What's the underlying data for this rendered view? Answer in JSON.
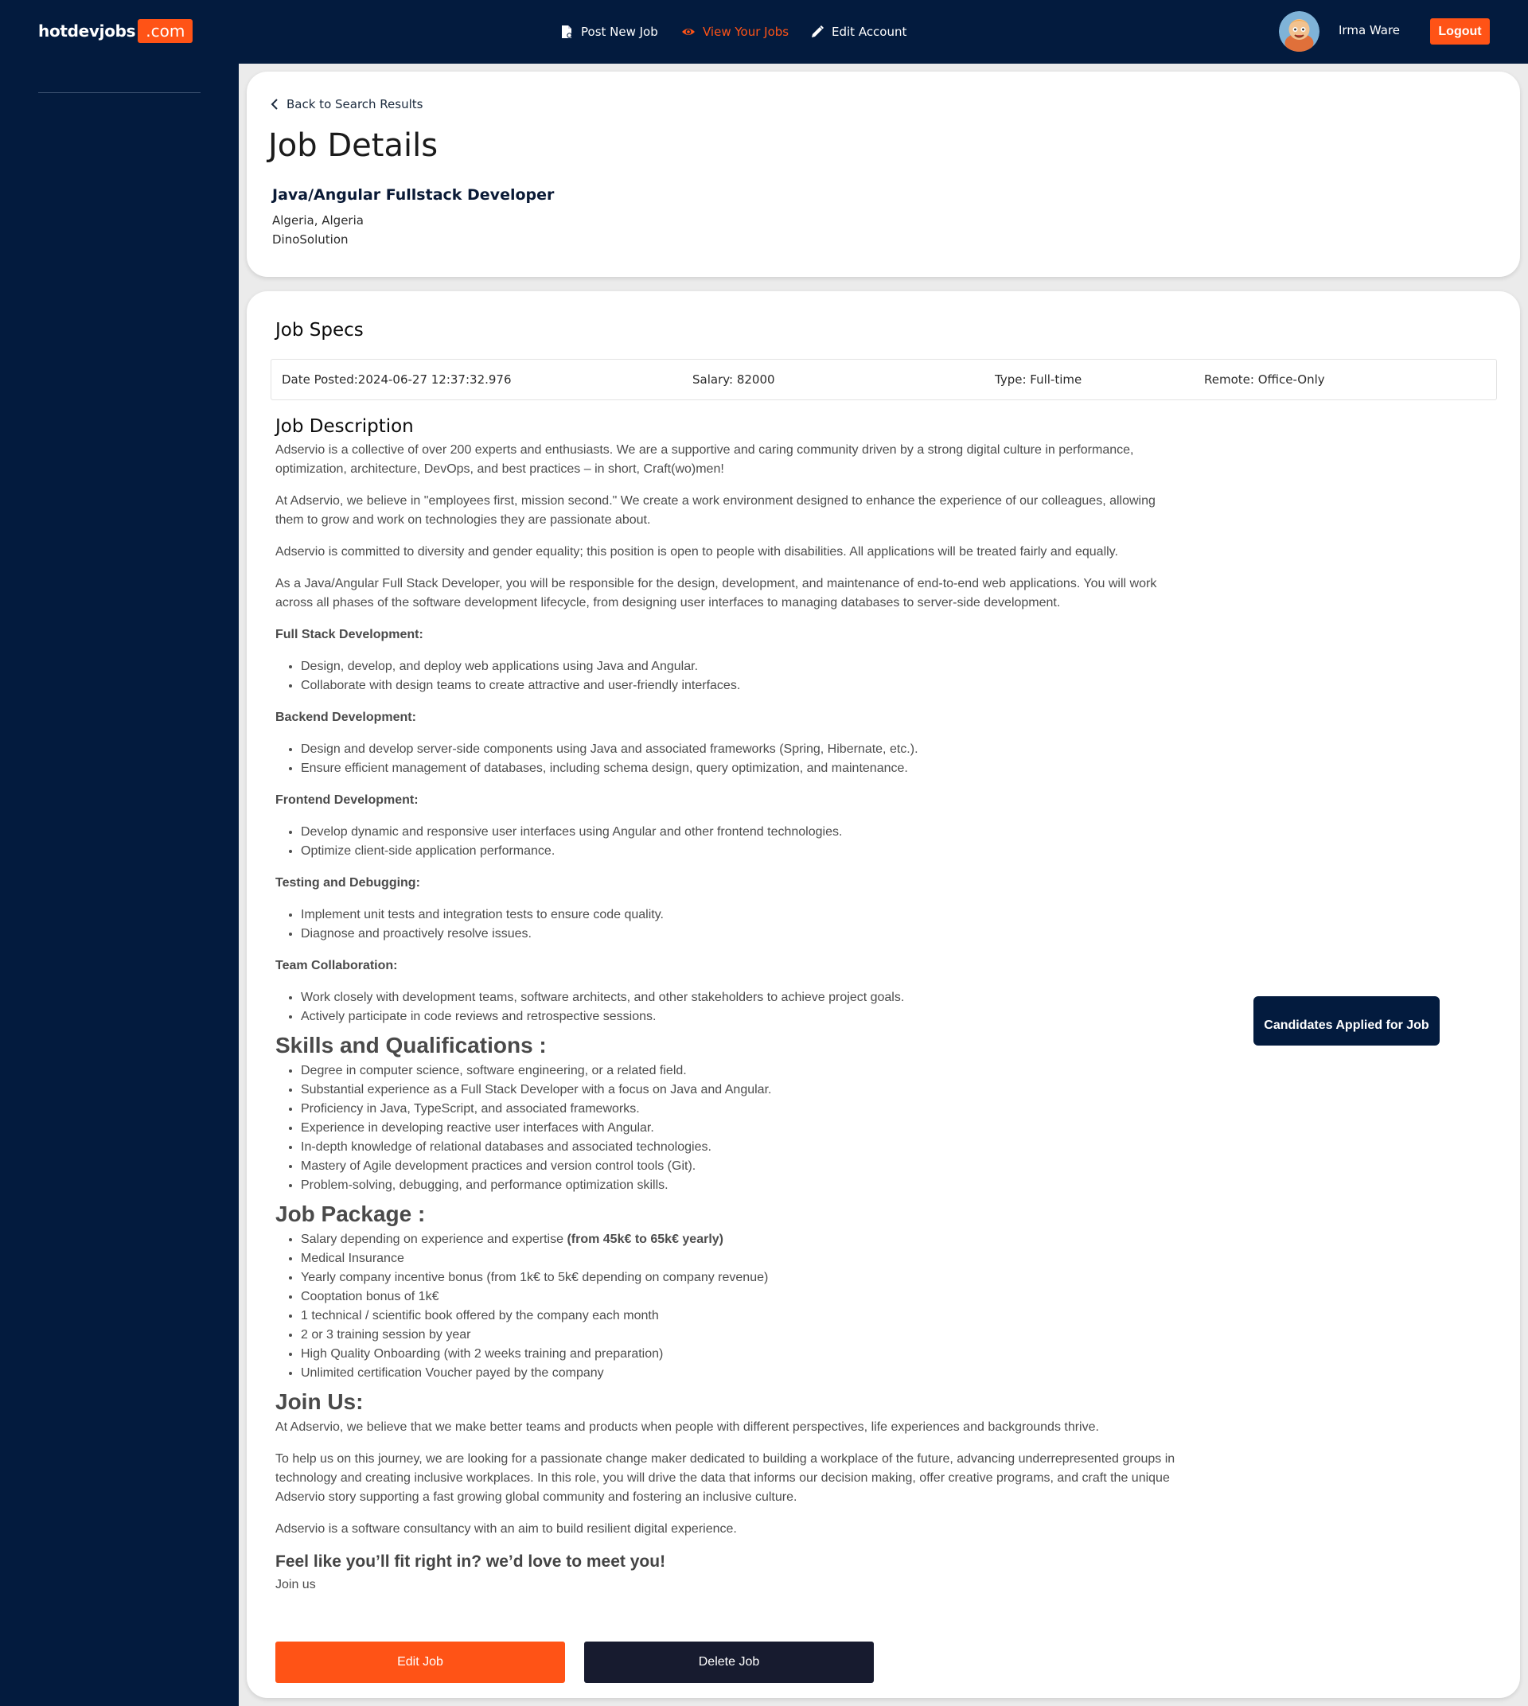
{
  "header": {
    "logo_main": "hotdevjobs",
    "logo_suffix": ".com",
    "nav": {
      "post_new_job": "Post New Job",
      "view_your_jobs": "View Your Jobs",
      "edit_account": "Edit Account"
    },
    "user_name": "Irma Ware",
    "logout_label": "Logout",
    "accent_color": "#ff5316",
    "background_color": "#031b3e"
  },
  "job": {
    "back_label": "Back to Search Results",
    "page_title": "Job Details",
    "title": "Java/Angular Fullstack Developer",
    "location": "Algeria, Algeria",
    "company": "DinoSolution"
  },
  "specs": {
    "heading": "Job Specs",
    "date_posted": "Date Posted:2024-06-27 12:37:32.976",
    "salary": "Salary: 82000",
    "type": "Type: Full-time",
    "remote": "Remote: Office-Only"
  },
  "description": {
    "heading": "Job Description",
    "intro": [
      "Adservio is a collective of over 200 experts and enthusiasts. We are a supportive and caring community driven by a strong digital culture in performance, optimization, architecture, DevOps, and best practices – in short, Craft(wo)men!",
      "At Adservio, we believe in \"employees first, mission second.\" We create a work environment designed to enhance the experience of our colleagues, allowing them to grow and work on technologies they are passionate about.",
      "Adservio is committed to diversity and gender equality; this position is open to people with disabilities. All applications will be treated fairly and equally.",
      "As a Java/Angular Full Stack Developer, you will be responsible for the design, development, and maintenance of end-to-end web applications. You will work across all phases of the software development lifecycle, from designing user interfaces to managing databases to server-side development."
    ],
    "sections": [
      {
        "title": "Full Stack Development:",
        "items": [
          "Design, develop, and deploy web applications using Java and Angular.",
          "Collaborate with design teams to create attractive and user-friendly interfaces."
        ]
      },
      {
        "title": "Backend Development:",
        "items": [
          "Design and develop server-side components using Java and associated frameworks (Spring, Hibernate, etc.).",
          "Ensure efficient management of databases, including schema design, query optimization, and maintenance."
        ]
      },
      {
        "title": "Frontend Development:",
        "items": [
          "Develop dynamic and responsive user interfaces using Angular and other frontend technologies.",
          "Optimize client-side application performance."
        ]
      },
      {
        "title": "Testing and Debugging:",
        "items": [
          "Implement unit tests and integration tests to ensure code quality.",
          "Diagnose and proactively resolve issues."
        ]
      },
      {
        "title": "Team Collaboration:",
        "items": [
          "Work closely with development teams, software architects, and other stakeholders to achieve project goals.",
          "Actively participate in code reviews and retrospective sessions."
        ]
      }
    ],
    "skills_heading": "Skills and Qualifications :",
    "skills": [
      "Degree in computer science, software engineering, or a related field.",
      "Substantial experience as a Full Stack Developer with a focus on Java and Angular.",
      "Proficiency in Java, TypeScript, and associated frameworks.",
      "Experience in developing reactive user interfaces with Angular.",
      "In-depth knowledge of relational databases and associated technologies.",
      "Mastery of Agile development practices and version control tools (Git).",
      "Problem-solving, debugging, and performance optimization skills."
    ],
    "package_heading": "Job Package :",
    "package_first_text": "Salary depending on experience and expertise ",
    "package_first_bold": "(from 45k€ to 65k€ yearly)",
    "package": [
      "Medical Insurance",
      "Yearly company incentive bonus (from 1k€ to 5k€ depending on company revenue)",
      "Cooptation bonus of 1k€",
      "1 technical / scientific book offered by the company each month",
      "2 or 3 training session by year",
      "High Quality Onboarding (with 2 weeks training and preparation)",
      "Unlimited certification Voucher payed by the company"
    ],
    "join_heading": "Join Us:",
    "join_paragraphs": [
      "At Adservio, we believe that we make better teams and products when people with different perspectives, life experiences and backgrounds thrive.",
      "To help us on this journey, we are looking for a passionate change maker dedicated to building a workplace of the future, advancing underrepresented groups in technology and creating inclusive workplaces. In this role, you will drive the data that informs our decision making, offer creative programs, and craft the unique Adservio story supporting a fast growing global community and fostering an inclusive culture.",
      "Adservio is a software consultancy with an aim to build resilient digital experience."
    ],
    "fit_heading": "Feel like you’ll fit right in? we’d love to meet you!",
    "join_us_text": "Join us"
  },
  "actions": {
    "candidates_label": "Candidates Applied for Job",
    "edit_label": "Edit Job",
    "delete_label": "Delete Job"
  }
}
